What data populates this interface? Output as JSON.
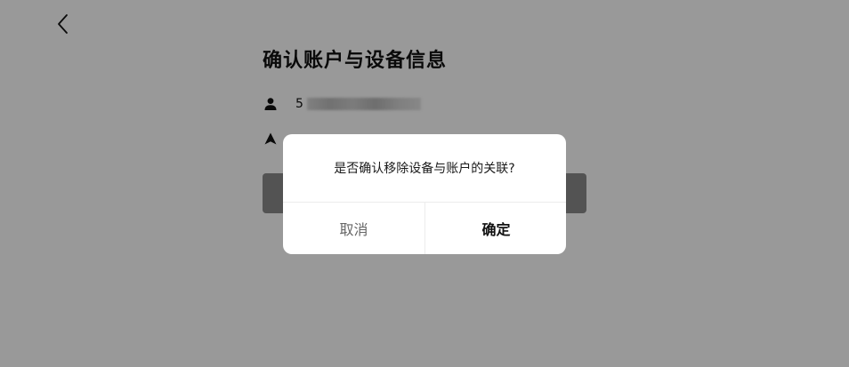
{
  "page": {
    "title": "确认账户与设备信息",
    "account_prefix": "5",
    "device_value": ""
  },
  "icons": {
    "back": "chevron-left-icon",
    "account": "person-icon",
    "device": "navigation-arrow-icon"
  },
  "dialog": {
    "message": "是否确认移除设备与账户的关联?",
    "cancel_label": "取消",
    "confirm_label": "确定"
  },
  "colors": {
    "overlay": "#999999",
    "dialog_bg": "#ffffff",
    "button_bg": "#8a8a8a",
    "cancel_text": "#666666",
    "confirm_text": "#111111"
  }
}
